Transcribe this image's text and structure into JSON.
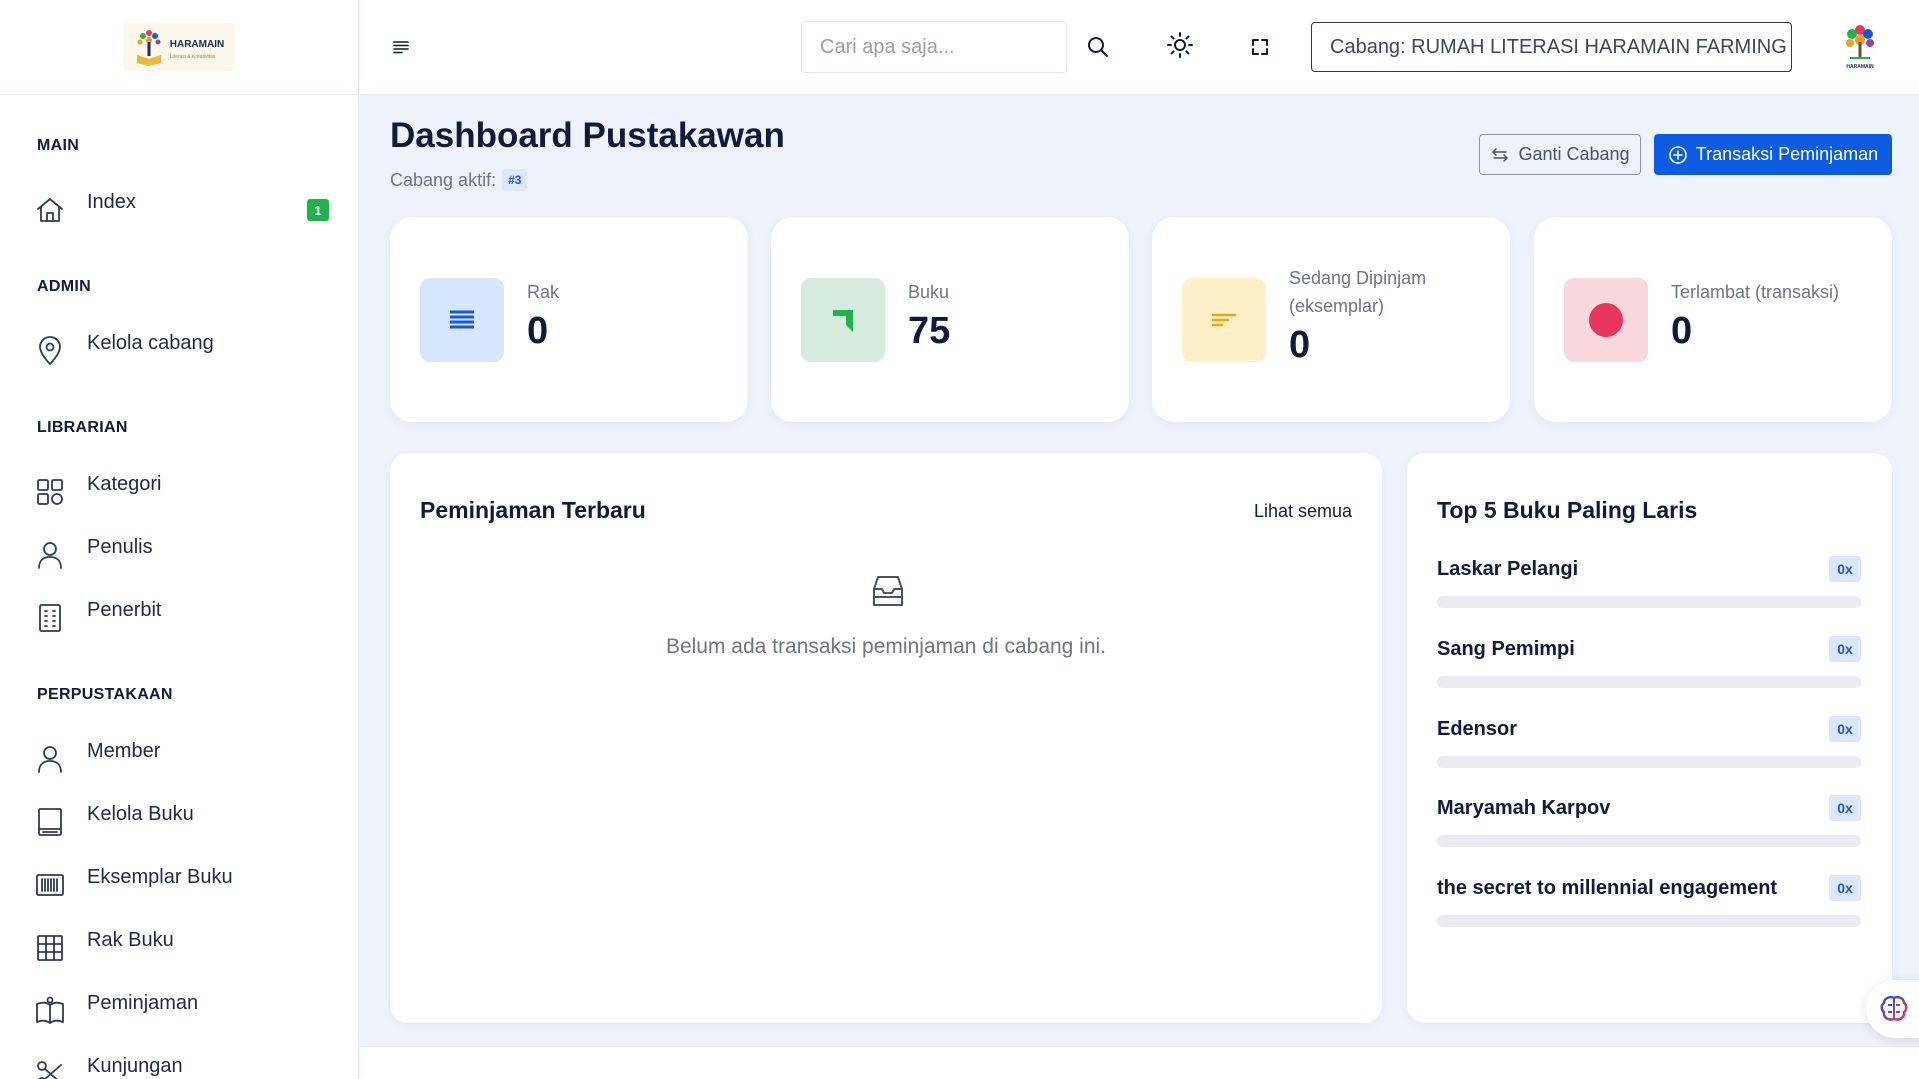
{
  "brand": {
    "name": "HARAMAIN",
    "tagline": "Literasi & Kreativitas",
    "avatar_text": "HARAMAIN"
  },
  "sidebar": {
    "sections": [
      {
        "title": "MAIN"
      },
      {
        "title": "ADMIN"
      },
      {
        "title": "LIBRARIAN"
      },
      {
        "title": "PERPUSTAKAAN"
      }
    ],
    "items": [
      {
        "label": "Index",
        "icon": "home-icon",
        "badge": "1"
      },
      {
        "label": "Kelola cabang",
        "icon": "map-pin-icon"
      },
      {
        "label": "Kategori",
        "icon": "grid-icon"
      },
      {
        "label": "Penulis",
        "icon": "user-icon"
      },
      {
        "label": "Penerbit",
        "icon": "building-icon"
      },
      {
        "label": "Member",
        "icon": "user-icon"
      },
      {
        "label": "Kelola Buku",
        "icon": "book-icon"
      },
      {
        "label": "Eksemplar Buku",
        "icon": "barcode-icon"
      },
      {
        "label": "Rak Buku",
        "icon": "table-grid-icon"
      },
      {
        "label": "Peminjaman",
        "icon": "open-book-icon"
      },
      {
        "label": "Kunjungan",
        "icon": "scissors-icon"
      }
    ]
  },
  "topbar": {
    "search_placeholder": "Cari apa saja...",
    "branch_label": "Cabang: RUMAH LITERASI HARAMAIN FARMING"
  },
  "page": {
    "title": "Dashboard Pustakawan",
    "active_branch_label": "Cabang aktif:",
    "active_branch_id": "#3",
    "btn_switch_branch": "Ganti Cabang",
    "btn_new_loan": "Transaksi Peminjaman"
  },
  "stats": [
    {
      "label": "Rak",
      "value": "0",
      "icon": "list-icon",
      "bg": "#d6e6fd",
      "fg": "#1a56db"
    },
    {
      "label": "Buku",
      "value": "75",
      "icon": "bookmark-icon",
      "bg": "#d5ebe0",
      "fg": "#22b24c"
    },
    {
      "label": "Sedang Dipinjam (eksemplar)",
      "value": "0",
      "icon": "lines-icon",
      "bg": "#fdf0c8",
      "fg": "#e6a817"
    },
    {
      "label": "Terlambat (transaksi)",
      "value": "0",
      "icon": "dot-icon",
      "bg": "#f8d7dd",
      "fg": "#e8365d"
    }
  ],
  "recent_loans": {
    "title": "Peminjaman Terbaru",
    "see_all": "Lihat semua",
    "empty_text": "Belum ada transaksi peminjaman di cabang ini."
  },
  "top_books": {
    "title": "Top 5 Buku Paling Laris",
    "items": [
      {
        "name": "Laskar Pelangi",
        "count": "0x",
        "progress": 0
      },
      {
        "name": "Sang Pemimpi",
        "count": "0x",
        "progress": 0
      },
      {
        "name": "Edensor",
        "count": "0x",
        "progress": 0
      },
      {
        "name": "Maryamah Karpov",
        "count": "0x",
        "progress": 0
      },
      {
        "name": "the secret to millennial engagement",
        "count": "0x",
        "progress": 0
      }
    ]
  }
}
